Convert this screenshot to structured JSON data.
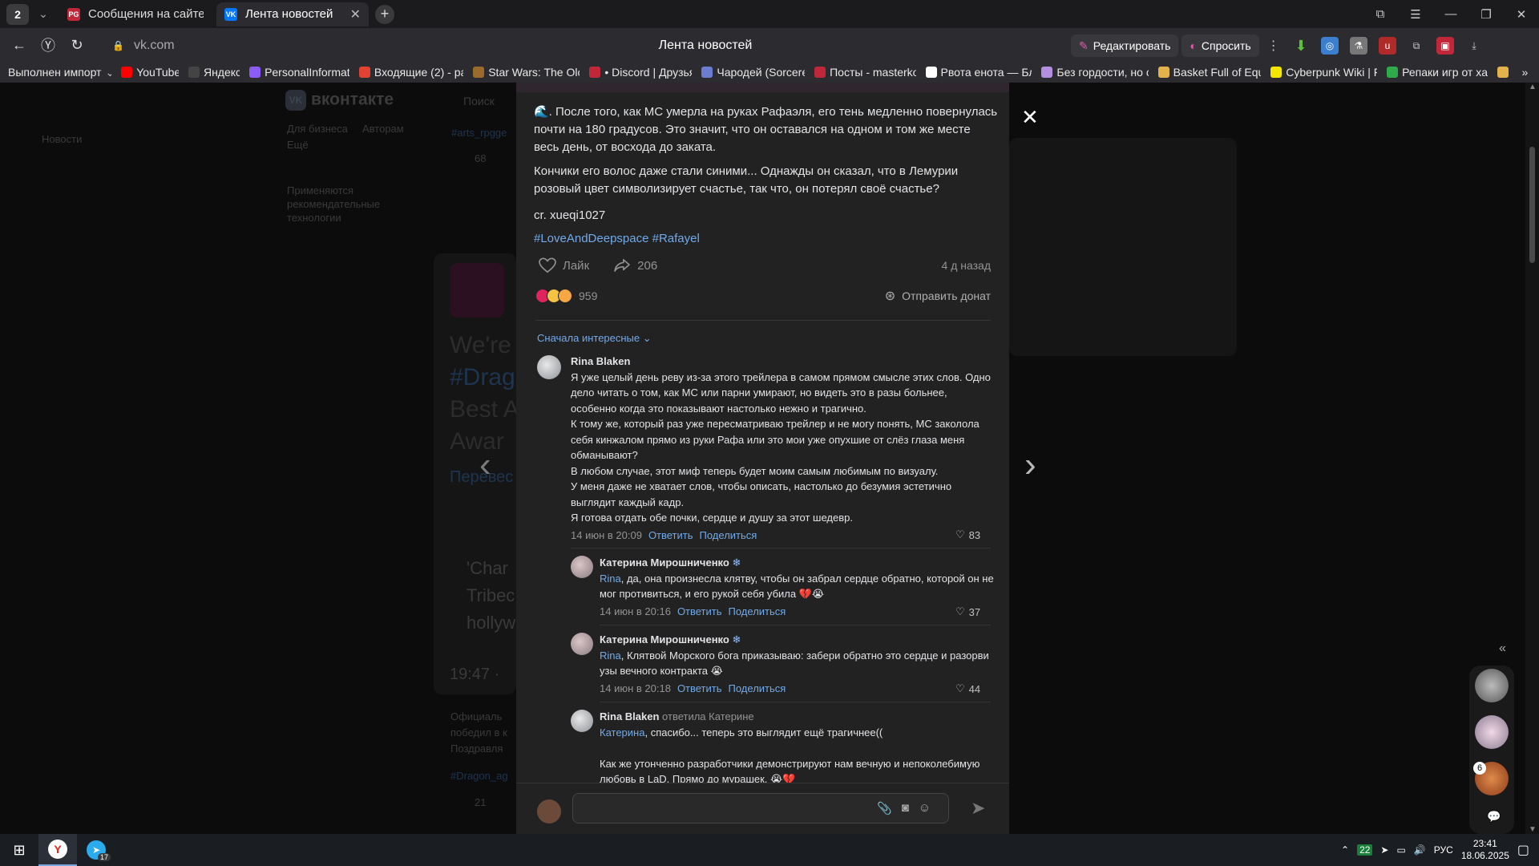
{
  "browser": {
    "tab_count": "2",
    "tabs": [
      {
        "title": "Сообщения на сайте",
        "active": false
      },
      {
        "title": "Лента новостей",
        "active": true
      }
    ],
    "url": "vk.com",
    "page_title": "Лента новостей",
    "actions": {
      "edit": "Редактировать",
      "ask": "Спросить"
    },
    "bookmarks": [
      "Выполнен импорт",
      "YouTube",
      "Яндекс",
      "PersonalInformati",
      "Входящие (2) - pa",
      "Star Wars: The Olc",
      "• Discord | Друзья",
      "Чародей (Sorcere",
      "Посты - masterko",
      "Рвота енота — Бл",
      "Без гордости, но с",
      "Basket Full of Equ",
      "Cyberpunk Wiki | F",
      "Репаки игр от xat"
    ]
  },
  "vk_background": {
    "logo": "вконтакте",
    "search": "Поиск",
    "news": "Новости",
    "for_business": "Для бизнеса",
    "authors": "Авторам",
    "more": "Ещё",
    "recommend": "Применяются рекомендательные технологии",
    "tag": "#arts_rpgge",
    "like_count": "68",
    "big_text": [
      "We're",
      "#Drag",
      "Best A",
      "Awar"
    ],
    "translate": "Перевес",
    "quote": [
      "'Char",
      "Tribec",
      "hollyw"
    ],
    "time": "19:47 ·",
    "official": [
      "Официаль",
      "победил в к",
      "Поздравля"
    ],
    "tag2": "#Dragon_ag",
    "like2": "21"
  },
  "post": {
    "paragraphs": [
      "🌊. После того, как МС умерла на руках Рафаэля, его тень медленно повернулась почти на 180 градусов. Это значит, что он оставался на одном и том же месте весь день, от восхода до заката.",
      "Кончики его волос даже стали синими... Однажды он сказал, что в Лемурии розовый цвет символизирует счастье, так что, он потерял своё счастье?",
      "cr. xueqi1027"
    ],
    "hashtags": "#LoveAndDeepspace #Rafayel",
    "like_label": "Лайк",
    "shares": "206",
    "time_ago": "4 д назад",
    "reactions_count": "959",
    "donate_label": "Отправить донат",
    "sort_label": "Сначала интересные"
  },
  "comments": [
    {
      "author": "Rina Blaken",
      "text": "Я уже целый день реву из-за этого трейлера в самом прямом смысле этих слов. Одно дело читать о том, как МС или парни умирают, но видеть это в разы больнее, особенно когда это показывают настолько нежно и трагично.\nК тому же, который раз уже пересматриваю трейлер и не могу понять, МС заколола себя кинжалом прямо из руки Рафа или это мои уже опухшие от слёз глаза меня обманывают?\nВ любом случае, этот миф теперь будет моим самым любимым по визуалу.\nУ меня даже не хватает слов, чтобы описать, настолько до безумия эстетично выглядит каждый кадр.\nЯ готова отдать обе почки, сердце и душу за этот шедевр.",
      "date": "14 июн в 20:09",
      "reply": "Ответить",
      "share": "Поделиться",
      "likes": "83"
    },
    {
      "author": "Катерина Мирошниченко",
      "mention": "Rina",
      "text": ", да, она произнесла клятву, чтобы он забрал сердце обратно, которой он не мог противиться, и его рукой себя убила 💔😭",
      "date": "14 июн в 20:16",
      "reply": "Ответить",
      "share": "Поделиться",
      "likes": "37"
    },
    {
      "author": "Катерина Мирошниченко",
      "mention": "Rina",
      "text": ", Клятвой Морского бога приказываю: забери обратно это сердце и разорви узы вечного контракта 😭",
      "date": "14 июн в 20:18",
      "reply": "Ответить",
      "share": "Поделиться",
      "likes": "44"
    },
    {
      "author": "Rina Blaken",
      "replied_to": "ответила Катерине",
      "mention": "Катерина",
      "text": ", спасибо... теперь это выглядит ещё трагичнее((\n\nКак же утонченно разработчики демонстрируют нам вечную и непоколебимую любовь в LaD. Прямо до мурашек. 😭💔"
    }
  ],
  "side_chat_badge": "6",
  "taskbar": {
    "telegram_badge": "17",
    "tray_badge": "22",
    "lang": "РУС",
    "time": "23:41",
    "date": "18.06.2025"
  },
  "colors": {
    "link": "#71aaeb",
    "modal_bg": "#222222",
    "text": "#e1e3e6",
    "muted": "#939393"
  }
}
